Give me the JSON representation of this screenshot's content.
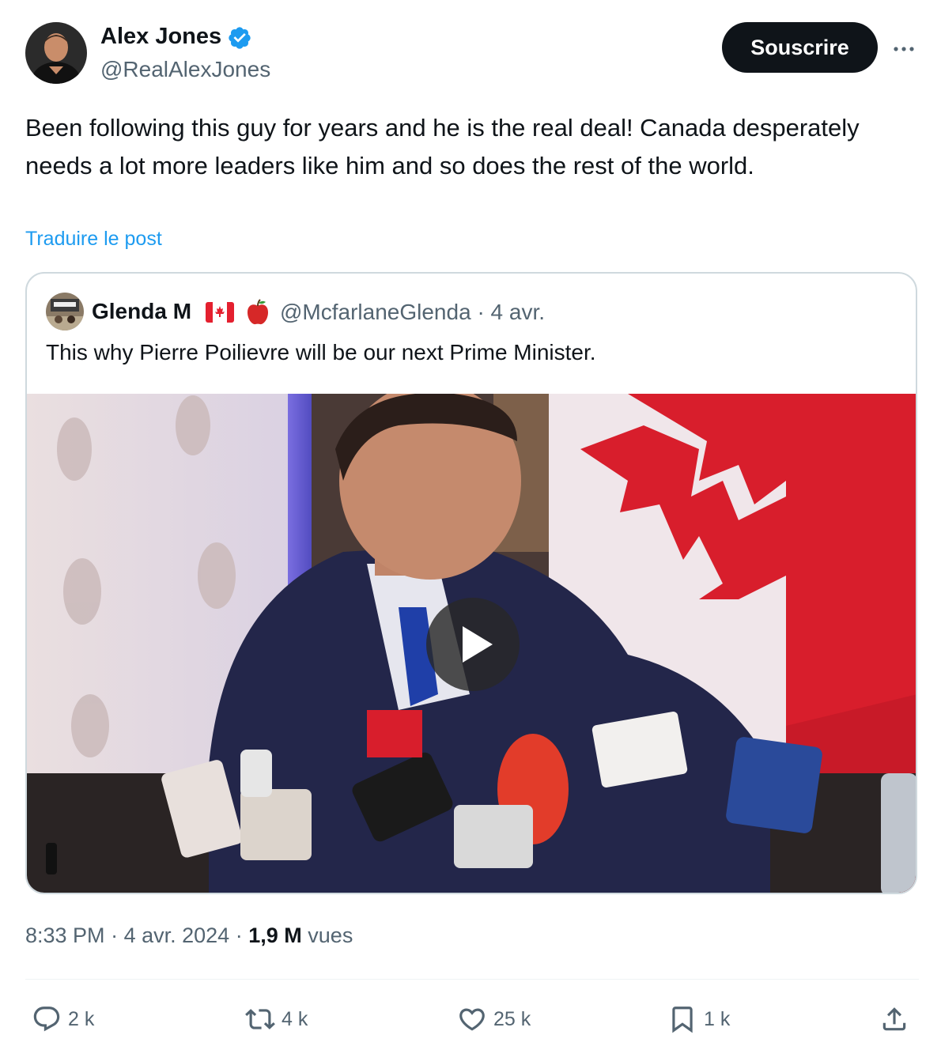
{
  "author": {
    "name": "Alex Jones",
    "handle": "@RealAlexJones",
    "verified_color": "#1d9bf0",
    "avatar_icon": "user-avatar"
  },
  "subscribe_label": "Souscrire",
  "more_icon": "more-options-icon",
  "post": {
    "text": "Been following this guy for years and he is the real deal! Canada desperately needs a lot more leaders like him and so does the rest of the world.",
    "translate_label": "Traduire le post"
  },
  "quote": {
    "name": "Glenda M",
    "handle": "@McfarlaneGlenda",
    "separator": "·",
    "date": "4 avr.",
    "text": "This why Pierre Poilievre will be our next Prime Minister.",
    "media_icon": "video-play-icon"
  },
  "meta": {
    "time": "8:33 PM",
    "separator": "·",
    "date": "4 avr. 2024",
    "views_count": "1,9 M",
    "views_label": "vues"
  },
  "actions": {
    "replies": "2 k",
    "reposts": "4 k",
    "likes": "25 k",
    "bookmarks": "1 k"
  },
  "colors": {
    "accent": "#1d9bf0",
    "text_primary": "#0f1419",
    "text_secondary": "#536471",
    "border": "#cfd9de"
  }
}
